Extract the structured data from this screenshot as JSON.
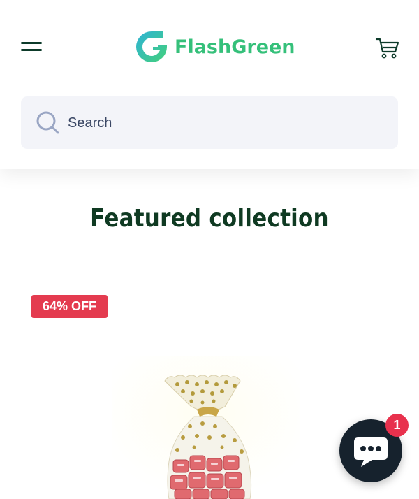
{
  "header": {
    "menu_icon": "hamburger-icon",
    "logo_text": "FlashGreen",
    "cart_icon": "cart-icon",
    "brand_colors": {
      "logo_gradient_start": "#2fb3d6",
      "logo_gradient_end": "#43d07a",
      "dark_green": "#0d3b2a"
    }
  },
  "search": {
    "placeholder": "Search",
    "icon": "search-icon"
  },
  "featured": {
    "title": "Featured collection",
    "products": [
      {
        "badge": "64% OFF",
        "badge_color": "#e43b4f"
      }
    ]
  },
  "chat": {
    "icon": "chat-bubble-icon",
    "unread_count": "1",
    "badge_color": "#e8314d"
  }
}
